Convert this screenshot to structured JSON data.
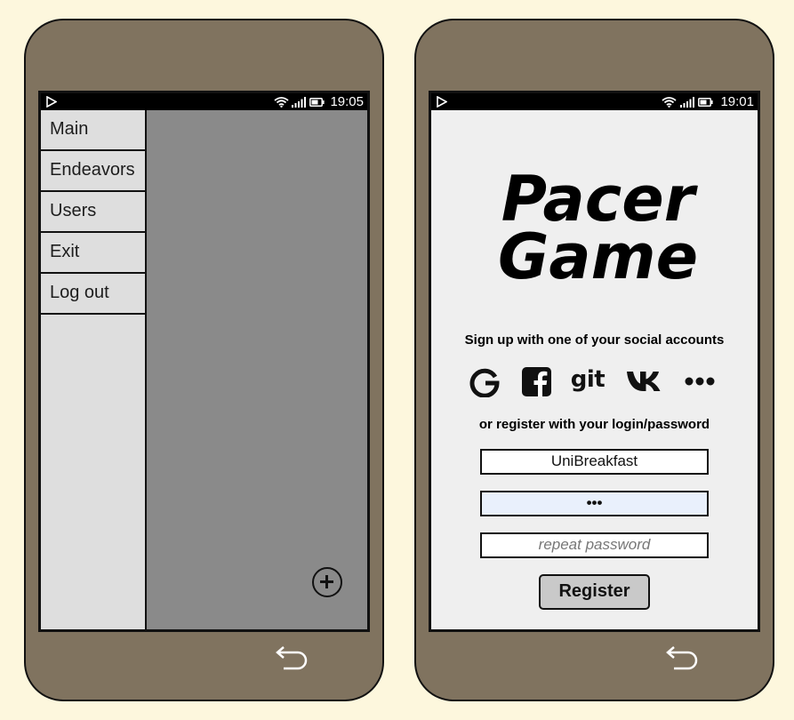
{
  "left_phone": {
    "status": {
      "time": "19:05"
    },
    "drawer": {
      "items": [
        {
          "label": "Main"
        },
        {
          "label": "Endeavors"
        },
        {
          "label": "Users"
        },
        {
          "label": "Exit"
        },
        {
          "label": "Log out"
        }
      ]
    },
    "fab_icon": "plus-icon",
    "back_icon": "back-arrow-icon"
  },
  "right_phone": {
    "status": {
      "time": "19:01"
    },
    "logo": {
      "line1": "Pacer",
      "line2": "Game"
    },
    "social_heading": "Sign up with one of your social accounts",
    "social_buttons": [
      {
        "icon": "google-icon"
      },
      {
        "icon": "facebook-icon"
      },
      {
        "icon": "git-icon",
        "label": "git"
      },
      {
        "icon": "vk-icon"
      },
      {
        "icon": "more-icon"
      }
    ],
    "register_heading": "or register with your login/password",
    "login_field": {
      "value": "UniBreakfast"
    },
    "password_field": {
      "value": "•••"
    },
    "repeat_field": {
      "placeholder": "repeat password"
    },
    "register_button": "Register",
    "back_icon": "back-arrow-icon"
  },
  "colors": {
    "page_background": "#fdf7dd",
    "phone_body": "#80735f",
    "drawer_background": "#dedede",
    "overlay": "#8a8a8a",
    "screen_background": "#efefef",
    "focused_field": "#e9f0fc",
    "button": "#c9c9c9"
  }
}
